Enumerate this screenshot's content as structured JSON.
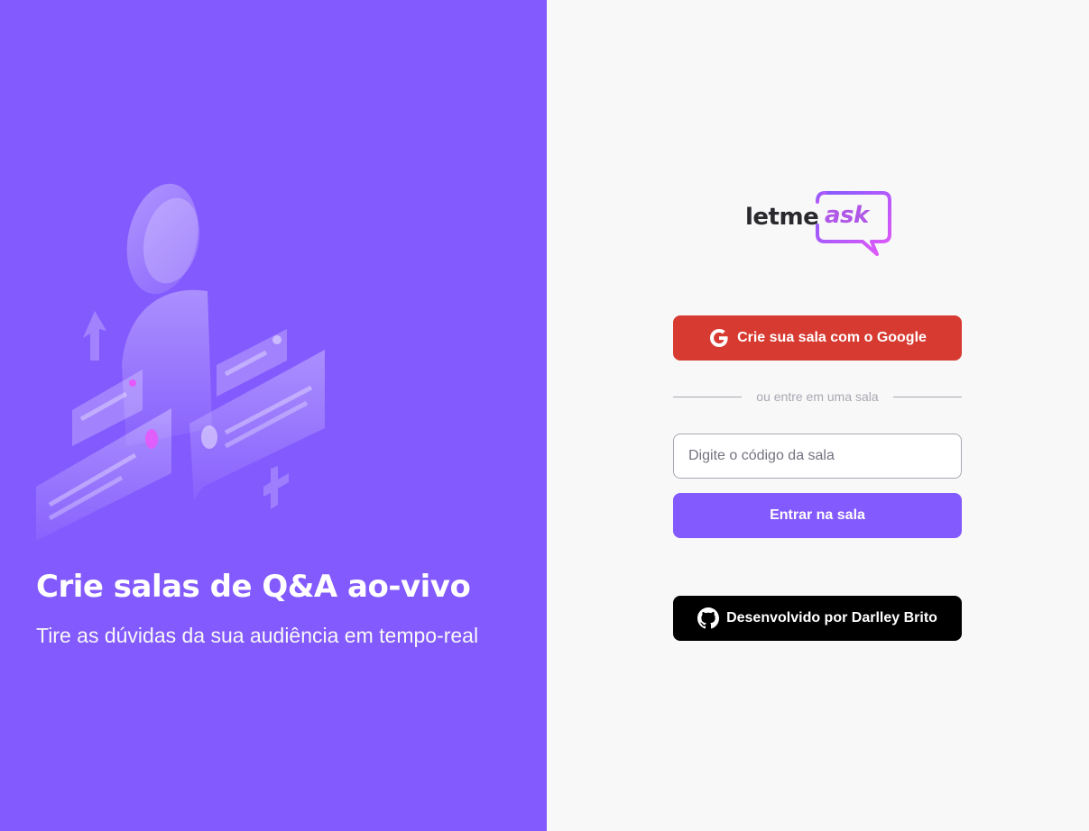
{
  "aside": {
    "title": "Crie salas de Q&A ao-vivo",
    "subtitle": "Tire as dúvidas da sua audiência em tempo-real",
    "background": "#835afd",
    "illustration": "qa-people-illustration"
  },
  "logo": {
    "part1": "letme",
    "part2": "ask",
    "accent_from": "#835afd",
    "accent_to": "#e559f9"
  },
  "actions": {
    "google_button_label": "Crie sua sala com o Google",
    "google_icon": "google-icon",
    "google_color": "#d73a30",
    "separator_text": "ou entre em uma sala",
    "room_input_placeholder": "Digite o código da sala",
    "room_input_value": "",
    "enter_button_label": "Entrar na sala",
    "enter_color": "#835afd",
    "github_button_label": "Desenvolvido por Darlley Brito",
    "github_icon": "github-icon"
  }
}
